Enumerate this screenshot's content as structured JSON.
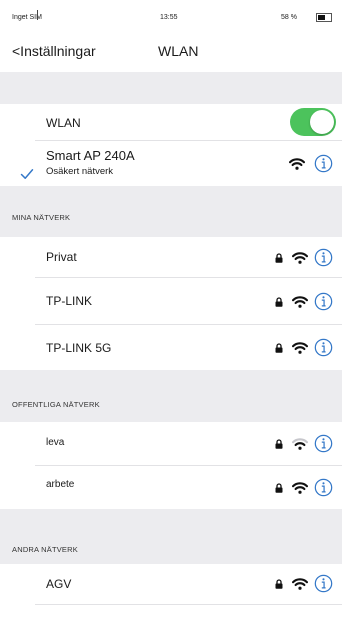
{
  "status_bar": {
    "carrier": "Inget SIM",
    "time": "13:55",
    "battery_percent_label": "58 %",
    "battery_level": 0.58
  },
  "nav": {
    "back_label": "<Inställningar",
    "title": "WLAN"
  },
  "wlan_toggle": {
    "label": "WLAN",
    "enabled": true
  },
  "current_network": {
    "name": "Smart AP 240A",
    "status": "Osäkert nätverk",
    "icons": [
      "check-icon",
      "wifi-icon",
      "info-icon"
    ]
  },
  "my_networks": {
    "header": "MINA NÄTVERK",
    "items": [
      {
        "name": "Privat",
        "locked": true
      },
      {
        "name": "TP-LINK",
        "locked": true
      },
      {
        "name": "TP-LINK 5G",
        "locked": true
      }
    ]
  },
  "public_networks": {
    "header": "OFFENTLIGA NÄTVERK",
    "items": [
      {
        "name": "leva",
        "locked": true,
        "signal": "weak"
      },
      {
        "name": "arbete",
        "locked": true,
        "signal": "full"
      }
    ]
  },
  "other_networks": {
    "header": "ANDRA NÄTVERK",
    "items": [
      {
        "name": "AGV",
        "locked": true
      }
    ]
  },
  "colors": {
    "accent": "#3478c8",
    "toggle_on": "#4cc35c",
    "group_background": "#ececef"
  }
}
